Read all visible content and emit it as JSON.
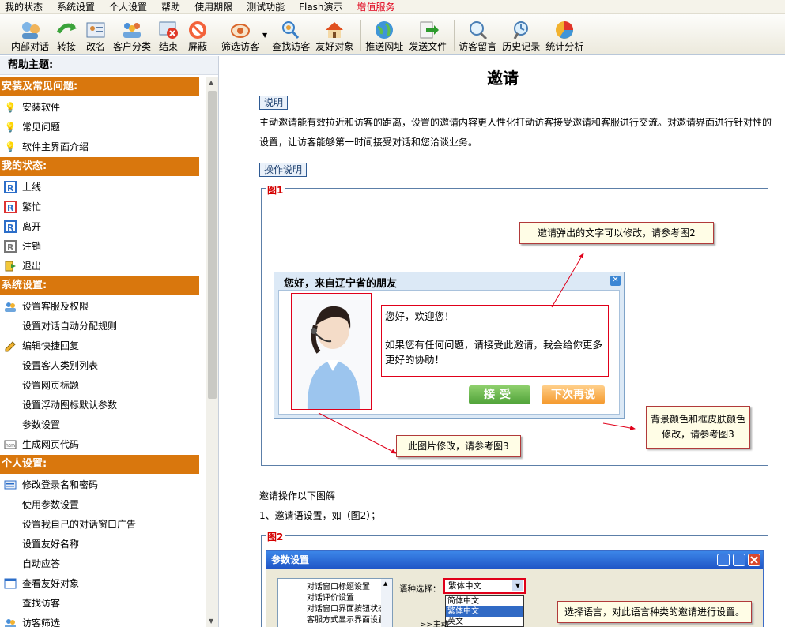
{
  "menu": [
    "我的状态",
    "系统设置",
    "个人设置",
    "帮助",
    "使用期限",
    "测试功能",
    "Flash演示",
    "增值服务"
  ],
  "toolbar": {
    "group1": [
      "内部对话",
      "转接",
      "改名",
      "客户分类",
      "结束",
      "屏蔽"
    ],
    "group2": [
      "筛选访客",
      "查找访客",
      "友好对象"
    ],
    "group3": [
      "推送网址",
      "发送文件"
    ],
    "group4": [
      "访客留言",
      "历史记录",
      "统计分析"
    ]
  },
  "sidebar": {
    "title": "帮助主题:",
    "sections": [
      {
        "title": "安装及常见问题:",
        "items": [
          "安装软件",
          "常见问题",
          "软件主界面介绍"
        ]
      },
      {
        "title": "我的状态:",
        "items": [
          "上线",
          "繁忙",
          "离开",
          "注销",
          "退出"
        ]
      },
      {
        "title": "系统设置:",
        "items": [
          "设置客服及权限",
          "设置对话自动分配规则",
          "编辑快捷回复",
          "设置客人类别列表",
          "设置网页标题",
          "设置浮动图标默认参数",
          "参数设置",
          "生成网页代码"
        ]
      },
      {
        "title": "个人设置:",
        "items": [
          "修改登录名和密码",
          "使用参数设置",
          "设置我自己的对话窗口广告",
          "设置友好名称",
          "自动应答",
          "查看友好对象",
          "查找访客",
          "访客筛选"
        ]
      }
    ]
  },
  "main": {
    "title": "邀请",
    "tag_desc": "说明",
    "desc": "主动邀请能有效拉近和访客的距离，设置的邀请内容更人性化打动访客接受邀请和客服进行交流。对邀请界面进行针对性的设置，让访客能够第一时间接受对话和您洽谈业务。",
    "tag_ops": "操作说明",
    "fig1_label": "图1",
    "popup_title": "您好，来自辽宁省的朋友",
    "popup_msg1": "您好，欢迎您！",
    "popup_msg2": "如果您有任何问题，请接受此邀请，我会给你更多更好的协助！",
    "btn_accept": "接受",
    "btn_later": "下次再说",
    "callout1": "邀请弹出的文字可以修改，请参考图2",
    "callout2": "背景颜色和框皮肤颜色修改，请参考图3",
    "callout3": "此图片修改，请参考图3",
    "ops_intro": "邀请操作以下图解",
    "step1": "1、邀请语设置，如（图2）；",
    "fig2_label": "图2",
    "win_title": "参数设置",
    "tree_items": [
      "对话窗口标题设置",
      "对话评价设置",
      "对话窗口界面按钮状态",
      "客服方式显示界面设置"
    ],
    "lang_label": "语种选择：",
    "lang_selected": "繁体中文",
    "lang_options": [
      "简体中文",
      "繁体中文",
      "英文"
    ],
    "main_hint": ">>主动",
    "callout4": "选择语言，对此语言种类的邀请进行设置。"
  }
}
